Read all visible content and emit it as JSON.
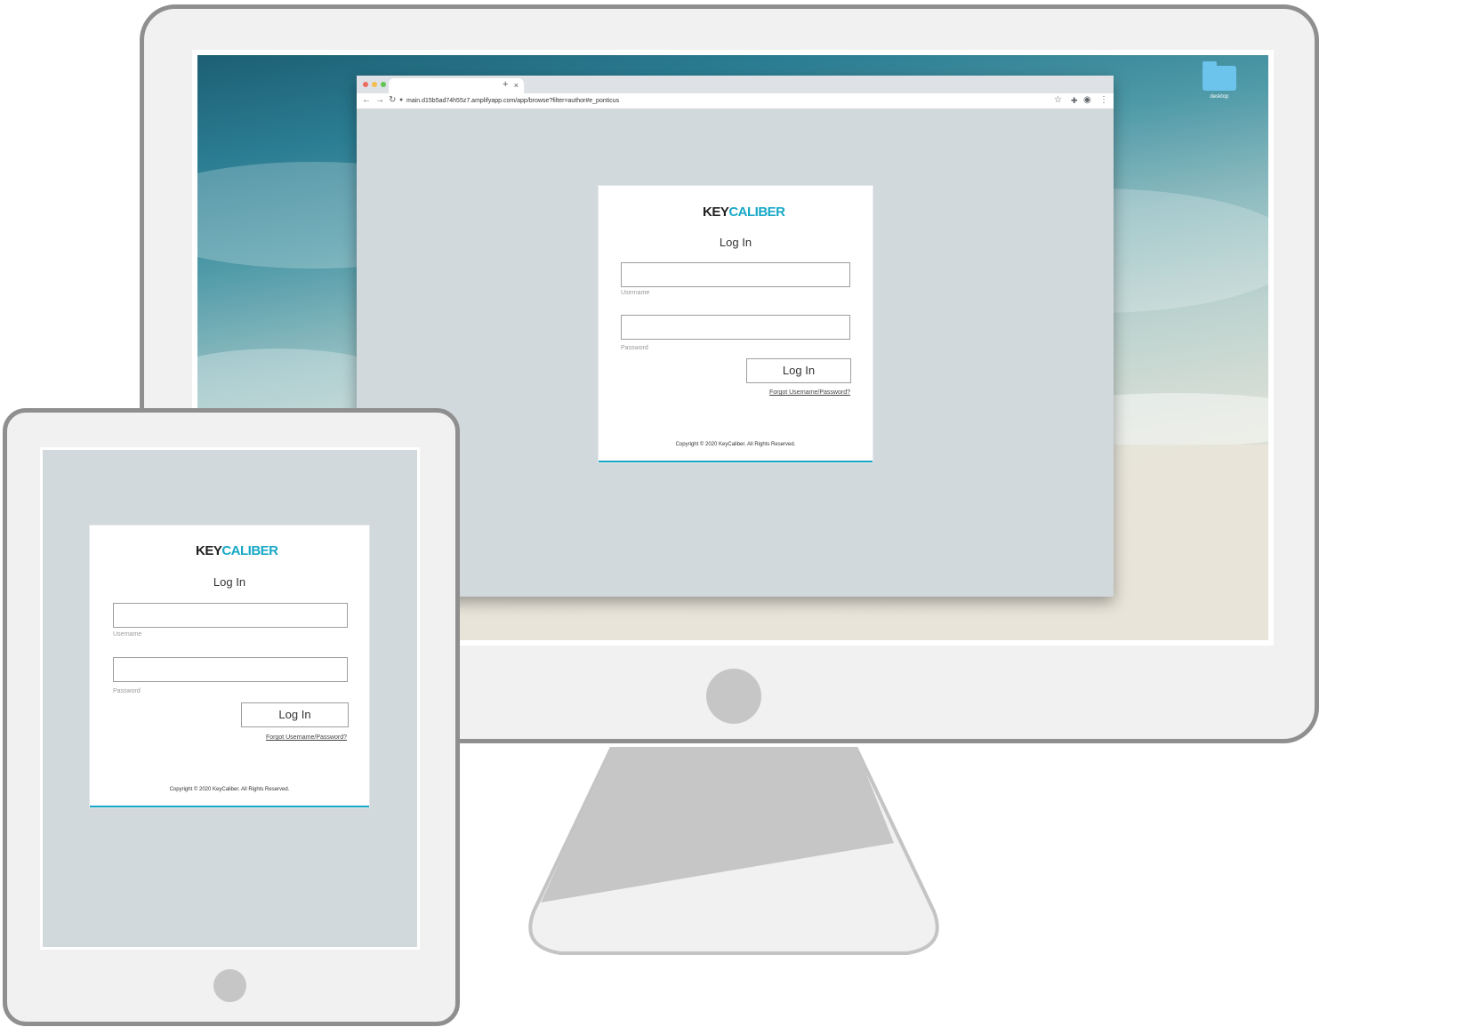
{
  "desktop": {
    "folder_label": "desktop",
    "folder_icon": "folder-icon"
  },
  "browser": {
    "url": "main.d15b5ad74h55z7.amplifyapp.com/app/browse?filter=author#e_ponticus",
    "tab_close": "×",
    "new_tab": "+",
    "icons": [
      "back-icon",
      "forward-icon",
      "reload-icon",
      "lock-icon",
      "star-icon",
      "extensions-icon",
      "profile-icon",
      "menu-icon"
    ]
  },
  "login": {
    "logo_part1": "KEY",
    "logo_part2": "CALIBER",
    "title": "Log In",
    "username_label": "Username",
    "password_label": "Password",
    "button_label": "Log In",
    "forgot_link": "Forgot Username/Password?",
    "copyright": "Copyright © 2020 KeyCaliber. All Rights Reserved."
  },
  "colors": {
    "accent": "#17a8c6",
    "page_background": "#d2d9dc",
    "device_frame": "#f1f1f1",
    "device_border": "#8f8f8f"
  }
}
